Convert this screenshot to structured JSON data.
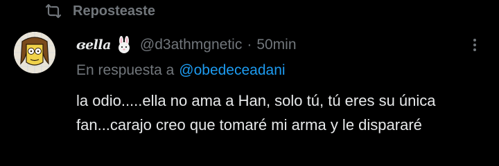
{
  "repost_banner": {
    "icon": "repost-icon",
    "text": "Reposteaste"
  },
  "tweet": {
    "avatar_icon": "cartoon-avatar",
    "display_name": "ɞella",
    "display_name_emoji": "rabbit-emoji",
    "handle": "@d3athmgnetic",
    "separator": "·",
    "time": "50min",
    "reply_prefix": "En respuesta a",
    "reply_to": "@obedeceadani",
    "more_icon": "more-dots-icon",
    "text": "la odio.....ella no ama a Han, solo tú, tú eres su única fan...carajo creo que tomaré mi arma y le dispararé"
  },
  "colors": {
    "background": "#000000",
    "text_primary": "#e7e9ea",
    "text_secondary": "#71767b",
    "link": "#1d9bf0"
  }
}
